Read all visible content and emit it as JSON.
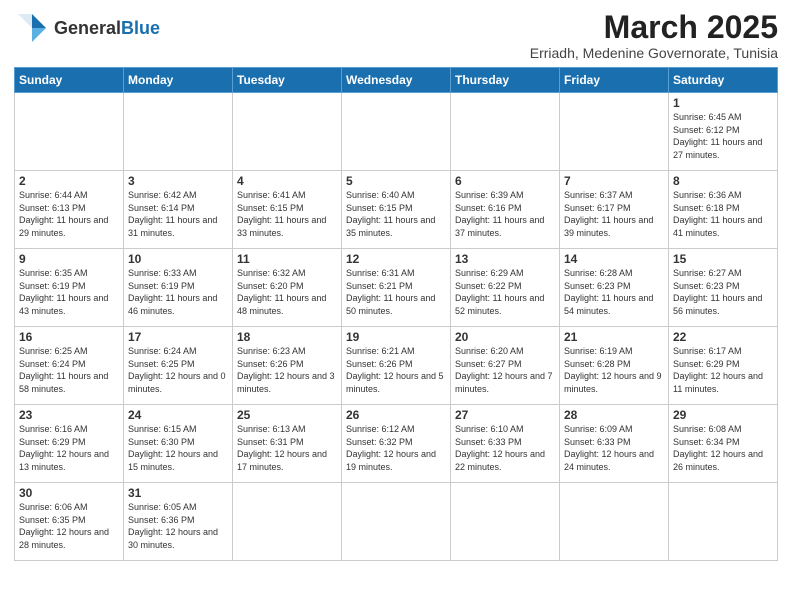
{
  "header": {
    "logo_general": "General",
    "logo_blue": "Blue",
    "title": "March 2025",
    "subtitle": "Erriadh, Medenine Governorate, Tunisia"
  },
  "weekdays": [
    "Sunday",
    "Monday",
    "Tuesday",
    "Wednesday",
    "Thursday",
    "Friday",
    "Saturday"
  ],
  "weeks": [
    [
      {
        "day": "",
        "info": ""
      },
      {
        "day": "",
        "info": ""
      },
      {
        "day": "",
        "info": ""
      },
      {
        "day": "",
        "info": ""
      },
      {
        "day": "",
        "info": ""
      },
      {
        "day": "",
        "info": ""
      },
      {
        "day": "1",
        "info": "Sunrise: 6:45 AM\nSunset: 6:12 PM\nDaylight: 11 hours\nand 27 minutes."
      }
    ],
    [
      {
        "day": "2",
        "info": "Sunrise: 6:44 AM\nSunset: 6:13 PM\nDaylight: 11 hours\nand 29 minutes."
      },
      {
        "day": "3",
        "info": "Sunrise: 6:42 AM\nSunset: 6:14 PM\nDaylight: 11 hours\nand 31 minutes."
      },
      {
        "day": "4",
        "info": "Sunrise: 6:41 AM\nSunset: 6:15 PM\nDaylight: 11 hours\nand 33 minutes."
      },
      {
        "day": "5",
        "info": "Sunrise: 6:40 AM\nSunset: 6:15 PM\nDaylight: 11 hours\nand 35 minutes."
      },
      {
        "day": "6",
        "info": "Sunrise: 6:39 AM\nSunset: 6:16 PM\nDaylight: 11 hours\nand 37 minutes."
      },
      {
        "day": "7",
        "info": "Sunrise: 6:37 AM\nSunset: 6:17 PM\nDaylight: 11 hours\nand 39 minutes."
      },
      {
        "day": "8",
        "info": "Sunrise: 6:36 AM\nSunset: 6:18 PM\nDaylight: 11 hours\nand 41 minutes."
      }
    ],
    [
      {
        "day": "9",
        "info": "Sunrise: 6:35 AM\nSunset: 6:19 PM\nDaylight: 11 hours\nand 43 minutes."
      },
      {
        "day": "10",
        "info": "Sunrise: 6:33 AM\nSunset: 6:19 PM\nDaylight: 11 hours\nand 46 minutes."
      },
      {
        "day": "11",
        "info": "Sunrise: 6:32 AM\nSunset: 6:20 PM\nDaylight: 11 hours\nand 48 minutes."
      },
      {
        "day": "12",
        "info": "Sunrise: 6:31 AM\nSunset: 6:21 PM\nDaylight: 11 hours\nand 50 minutes."
      },
      {
        "day": "13",
        "info": "Sunrise: 6:29 AM\nSunset: 6:22 PM\nDaylight: 11 hours\nand 52 minutes."
      },
      {
        "day": "14",
        "info": "Sunrise: 6:28 AM\nSunset: 6:23 PM\nDaylight: 11 hours\nand 54 minutes."
      },
      {
        "day": "15",
        "info": "Sunrise: 6:27 AM\nSunset: 6:23 PM\nDaylight: 11 hours\nand 56 minutes."
      }
    ],
    [
      {
        "day": "16",
        "info": "Sunrise: 6:25 AM\nSunset: 6:24 PM\nDaylight: 11 hours\nand 58 minutes."
      },
      {
        "day": "17",
        "info": "Sunrise: 6:24 AM\nSunset: 6:25 PM\nDaylight: 12 hours\nand 0 minutes."
      },
      {
        "day": "18",
        "info": "Sunrise: 6:23 AM\nSunset: 6:26 PM\nDaylight: 12 hours\nand 3 minutes."
      },
      {
        "day": "19",
        "info": "Sunrise: 6:21 AM\nSunset: 6:26 PM\nDaylight: 12 hours\nand 5 minutes."
      },
      {
        "day": "20",
        "info": "Sunrise: 6:20 AM\nSunset: 6:27 PM\nDaylight: 12 hours\nand 7 minutes."
      },
      {
        "day": "21",
        "info": "Sunrise: 6:19 AM\nSunset: 6:28 PM\nDaylight: 12 hours\nand 9 minutes."
      },
      {
        "day": "22",
        "info": "Sunrise: 6:17 AM\nSunset: 6:29 PM\nDaylight: 12 hours\nand 11 minutes."
      }
    ],
    [
      {
        "day": "23",
        "info": "Sunrise: 6:16 AM\nSunset: 6:29 PM\nDaylight: 12 hours\nand 13 minutes."
      },
      {
        "day": "24",
        "info": "Sunrise: 6:15 AM\nSunset: 6:30 PM\nDaylight: 12 hours\nand 15 minutes."
      },
      {
        "day": "25",
        "info": "Sunrise: 6:13 AM\nSunset: 6:31 PM\nDaylight: 12 hours\nand 17 minutes."
      },
      {
        "day": "26",
        "info": "Sunrise: 6:12 AM\nSunset: 6:32 PM\nDaylight: 12 hours\nand 19 minutes."
      },
      {
        "day": "27",
        "info": "Sunrise: 6:10 AM\nSunset: 6:33 PM\nDaylight: 12 hours\nand 22 minutes."
      },
      {
        "day": "28",
        "info": "Sunrise: 6:09 AM\nSunset: 6:33 PM\nDaylight: 12 hours\nand 24 minutes."
      },
      {
        "day": "29",
        "info": "Sunrise: 6:08 AM\nSunset: 6:34 PM\nDaylight: 12 hours\nand 26 minutes."
      }
    ],
    [
      {
        "day": "30",
        "info": "Sunrise: 6:06 AM\nSunset: 6:35 PM\nDaylight: 12 hours\nand 28 minutes."
      },
      {
        "day": "31",
        "info": "Sunrise: 6:05 AM\nSunset: 6:36 PM\nDaylight: 12 hours\nand 30 minutes."
      },
      {
        "day": "",
        "info": ""
      },
      {
        "day": "",
        "info": ""
      },
      {
        "day": "",
        "info": ""
      },
      {
        "day": "",
        "info": ""
      },
      {
        "day": "",
        "info": ""
      }
    ]
  ]
}
